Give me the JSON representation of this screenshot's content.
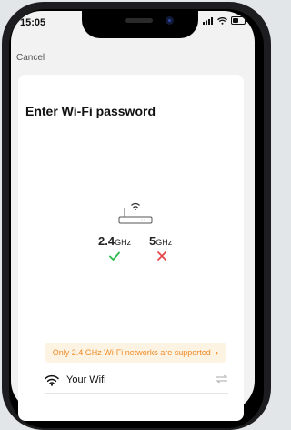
{
  "status_bar": {
    "time": "15:05"
  },
  "nav": {
    "cancel_label": "Cancel"
  },
  "main": {
    "title": "Enter Wi-Fi password",
    "band_24": {
      "value": "2.4",
      "unit": "GHz",
      "supported": true
    },
    "band_5": {
      "value": "5",
      "unit": "GHz",
      "supported": false
    },
    "notice": "Only 2.4 GHz Wi-Fi networks are supported",
    "notice_chevron": "›",
    "wifi_name": "Your Wifi"
  },
  "colors": {
    "accent_orange": "#f08a24",
    "check_green": "#2db84d",
    "cross_red": "#e5484d"
  }
}
